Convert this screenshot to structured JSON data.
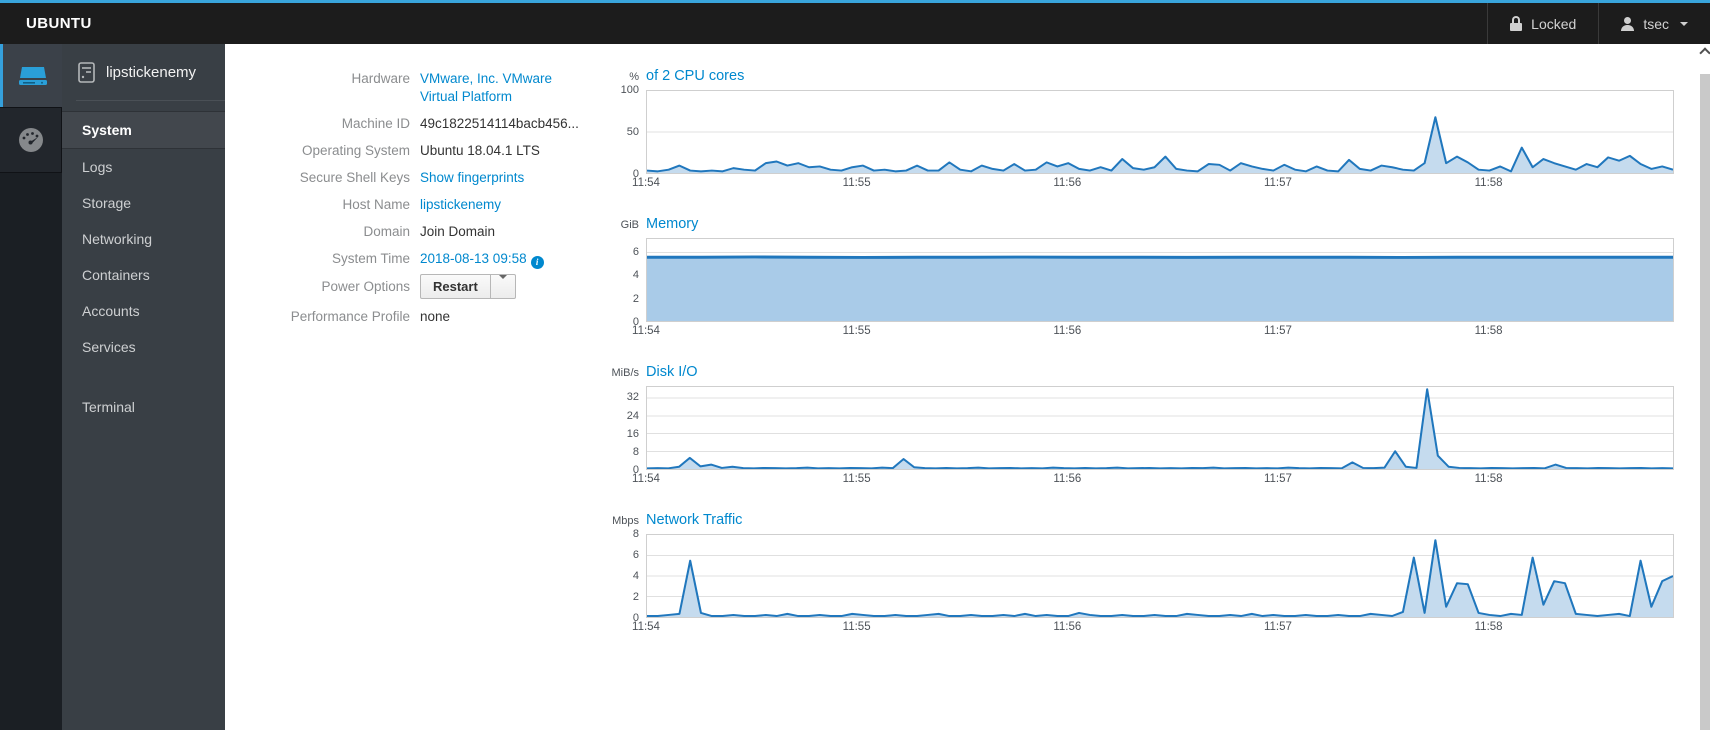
{
  "topbar": {
    "brand": "UBUNTU",
    "locked_label": "Locked",
    "user": "tsec"
  },
  "sidebar": {
    "host": "lipstickenemy",
    "items": [
      {
        "label": "System",
        "active": true
      },
      {
        "label": "Logs",
        "active": false
      },
      {
        "label": "Storage",
        "active": false
      },
      {
        "label": "Networking",
        "active": false
      },
      {
        "label": "Containers",
        "active": false
      },
      {
        "label": "Accounts",
        "active": false
      },
      {
        "label": "Services",
        "active": false
      }
    ],
    "secondary_items": [
      {
        "label": "Terminal"
      }
    ]
  },
  "system_info": {
    "rows": [
      {
        "label": "Hardware",
        "value": "VMware, Inc. VMware Virtual Platform",
        "type": "link"
      },
      {
        "label": "Machine ID",
        "value": "49c1822514114bacb456...",
        "type": "text"
      },
      {
        "label": "Operating System",
        "value": "Ubuntu 18.04.1 LTS",
        "type": "text"
      },
      {
        "label": "Secure Shell Keys",
        "value": "Show fingerprints",
        "type": "link"
      },
      {
        "label": "Host Name",
        "value": "lipstickenemy",
        "type": "link"
      },
      {
        "label": "Domain",
        "value": "Join Domain",
        "type": "text"
      },
      {
        "label": "System Time",
        "value": "2018-08-13 09:58",
        "type": "link",
        "icon": "info"
      },
      {
        "label": "Power Options",
        "value": "Restart",
        "type": "button"
      },
      {
        "label": "Performance Profile",
        "value": "none",
        "type": "text"
      }
    ]
  },
  "colors": {
    "accent": "#39a5dc",
    "link": "#0088ce",
    "chart_line": "#2077bd",
    "chart_fill": "#c5dbee",
    "memory_fill": "#a9cbe8"
  },
  "chart_data": [
    {
      "type": "area",
      "name": "cpu",
      "title": "of 2 CPU cores",
      "unit": "%",
      "ylim": [
        0,
        100
      ],
      "yticks": [
        0,
        50,
        100
      ],
      "grid": true,
      "stroke_width": 2,
      "line": "#2077bd",
      "fill": "#c5dbee",
      "x_max": 4.88,
      "x_tick_labels": [
        "11:54",
        "11:55",
        "11:56",
        "11:57",
        "11:58"
      ],
      "x_tick_pos": [
        0,
        1,
        2,
        3,
        4
      ],
      "values": [
        3,
        2,
        4,
        9,
        3,
        2,
        3,
        2,
        6,
        4,
        3,
        12,
        14,
        9,
        12,
        7,
        8,
        4,
        3,
        7,
        9,
        3,
        4,
        2,
        3,
        9,
        3,
        3,
        13,
        4,
        2,
        9,
        5,
        3,
        11,
        3,
        4,
        13,
        8,
        12,
        5,
        3,
        7,
        3,
        17,
        6,
        4,
        7,
        20,
        5,
        3,
        2,
        11,
        10,
        3,
        12,
        8,
        5,
        3,
        10,
        4,
        2,
        8,
        3,
        2,
        16,
        5,
        3,
        9,
        7,
        4,
        3,
        12,
        68,
        12,
        20,
        13,
        4,
        3,
        8,
        2,
        31,
        7,
        17,
        12,
        8,
        4,
        11,
        7,
        19,
        15,
        21,
        11,
        5,
        8,
        4
      ]
    },
    {
      "type": "area",
      "name": "memory",
      "title": "Memory",
      "unit": "GiB",
      "ylim": [
        0,
        7.2
      ],
      "yticks": [
        0,
        2,
        4,
        6
      ],
      "grid": true,
      "stroke_width": 3,
      "line": "#2077bd",
      "fill": "#a9cbe8",
      "x_max": 4.88,
      "x_tick_labels": [
        "11:54",
        "11:55",
        "11:56",
        "11:57",
        "11:58"
      ],
      "x_tick_pos": [
        0,
        1,
        2,
        3,
        4
      ],
      "values": [
        5.6,
        5.6,
        5.62,
        5.6,
        5.58,
        5.6,
        5.6,
        5.61,
        5.6,
        5.6,
        5.59,
        5.6,
        5.6,
        5.6,
        5.58,
        5.6,
        5.6,
        5.6,
        5.6,
        5.6
      ]
    },
    {
      "type": "area",
      "name": "disk-io",
      "title": "Disk I/O",
      "unit": "MiB/s",
      "ylim": [
        0,
        37
      ],
      "yticks": [
        0,
        8,
        16,
        24,
        32
      ],
      "grid": true,
      "stroke_width": 2,
      "line": "#2077bd",
      "fill": "#c5dbee",
      "x_max": 4.88,
      "x_tick_labels": [
        "11:54",
        "11:55",
        "11:56",
        "11:57",
        "11:58"
      ],
      "x_tick_pos": [
        0,
        1,
        2,
        3,
        4
      ],
      "values": [
        0.3,
        0.4,
        0.3,
        1,
        5,
        1.2,
        2,
        0.5,
        1,
        0.4,
        0.3,
        0.5,
        0.4,
        0.3,
        0.4,
        0.6,
        0.3,
        0.4,
        0.3,
        0.5,
        0.4,
        0.3,
        0.6,
        0.4,
        4.5,
        0.8,
        0.4,
        0.3,
        0.5,
        0.3,
        0.4,
        0.6,
        0.3,
        0.4,
        0.5,
        0.3,
        0.4,
        0.3,
        0.6,
        0.4,
        0.3,
        0.5,
        0.3,
        0.4,
        0.6,
        0.3,
        0.4,
        0.5,
        0.3,
        0.4,
        0.3,
        0.5,
        0.4,
        0.6,
        0.3,
        0.4,
        0.5,
        0.3,
        0.4,
        0.3,
        0.6,
        0.4,
        0.3,
        0.5,
        0.4,
        0.3,
        3,
        0.5,
        0.4,
        0.6,
        8,
        1,
        0.5,
        36,
        6,
        1,
        0.5,
        0.4,
        0.3,
        0.5,
        0.4,
        0.3,
        0.4,
        0.5,
        0.3,
        2,
        0.5,
        0.4,
        0.3,
        0.5,
        0.4,
        0.3,
        0.4,
        0.5,
        0.3,
        0.4,
        0.3
      ]
    },
    {
      "type": "area",
      "name": "network-traffic",
      "title": "Network Traffic",
      "unit": "Mbps",
      "ylim": [
        0,
        8
      ],
      "yticks": [
        0,
        2,
        4,
        6,
        8
      ],
      "grid": true,
      "stroke_width": 2,
      "line": "#2077bd",
      "fill": "#c5dbee",
      "x_max": 4.88,
      "x_tick_labels": [
        "11:54",
        "11:55",
        "11:56",
        "11:57",
        "11:58"
      ],
      "x_tick_pos": [
        0,
        1,
        2,
        3,
        4
      ],
      "values": [
        0.1,
        0.1,
        0.2,
        0.3,
        5.5,
        0.4,
        0.1,
        0.1,
        0.2,
        0.1,
        0.1,
        0.2,
        0.1,
        0.3,
        0.1,
        0.1,
        0.2,
        0.1,
        0.1,
        0.3,
        0.2,
        0.1,
        0.1,
        0.2,
        0.1,
        0.1,
        0.2,
        0.3,
        0.1,
        0.1,
        0.2,
        0.1,
        0.1,
        0.2,
        0.1,
        0.3,
        0.1,
        0.2,
        0.1,
        0.1,
        0.4,
        0.2,
        0.1,
        0.1,
        0.2,
        0.1,
        0.1,
        0.2,
        0.1,
        0.1,
        0.3,
        0.2,
        0.1,
        0.1,
        0.2,
        0.1,
        0.3,
        0.1,
        0.2,
        0.1,
        0.1,
        0.2,
        0.1,
        0.1,
        0.2,
        0.1,
        0.1,
        0.3,
        0.2,
        0.1,
        0.5,
        5.8,
        0.4,
        7.5,
        1,
        3.3,
        3.2,
        0.4,
        0.2,
        0.1,
        0.3,
        0.2,
        5.8,
        1.2,
        3.5,
        3.3,
        0.3,
        0.2,
        0.1,
        0.2,
        0.3,
        0.1,
        5.5,
        1,
        3.5,
        4
      ]
    }
  ]
}
